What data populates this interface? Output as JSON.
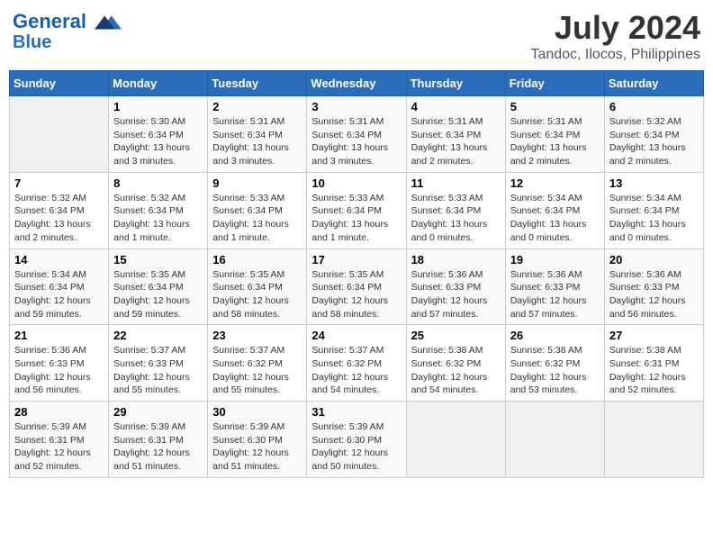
{
  "header": {
    "logo_line1": "General",
    "logo_line2": "Blue",
    "month": "July 2024",
    "location": "Tandoc, Ilocos, Philippines"
  },
  "weekdays": [
    "Sunday",
    "Monday",
    "Tuesday",
    "Wednesday",
    "Thursday",
    "Friday",
    "Saturday"
  ],
  "weeks": [
    [
      {
        "day": "",
        "info": ""
      },
      {
        "day": "1",
        "info": "Sunrise: 5:30 AM\nSunset: 6:34 PM\nDaylight: 13 hours\nand 3 minutes."
      },
      {
        "day": "2",
        "info": "Sunrise: 5:31 AM\nSunset: 6:34 PM\nDaylight: 13 hours\nand 3 minutes."
      },
      {
        "day": "3",
        "info": "Sunrise: 5:31 AM\nSunset: 6:34 PM\nDaylight: 13 hours\nand 3 minutes."
      },
      {
        "day": "4",
        "info": "Sunrise: 5:31 AM\nSunset: 6:34 PM\nDaylight: 13 hours\nand 2 minutes."
      },
      {
        "day": "5",
        "info": "Sunrise: 5:31 AM\nSunset: 6:34 PM\nDaylight: 13 hours\nand 2 minutes."
      },
      {
        "day": "6",
        "info": "Sunrise: 5:32 AM\nSunset: 6:34 PM\nDaylight: 13 hours\nand 2 minutes."
      }
    ],
    [
      {
        "day": "7",
        "info": "Sunrise: 5:32 AM\nSunset: 6:34 PM\nDaylight: 13 hours\nand 2 minutes."
      },
      {
        "day": "8",
        "info": "Sunrise: 5:32 AM\nSunset: 6:34 PM\nDaylight: 13 hours\nand 1 minute."
      },
      {
        "day": "9",
        "info": "Sunrise: 5:33 AM\nSunset: 6:34 PM\nDaylight: 13 hours\nand 1 minute."
      },
      {
        "day": "10",
        "info": "Sunrise: 5:33 AM\nSunset: 6:34 PM\nDaylight: 13 hours\nand 1 minute."
      },
      {
        "day": "11",
        "info": "Sunrise: 5:33 AM\nSunset: 6:34 PM\nDaylight: 13 hours\nand 0 minutes."
      },
      {
        "day": "12",
        "info": "Sunrise: 5:34 AM\nSunset: 6:34 PM\nDaylight: 13 hours\nand 0 minutes."
      },
      {
        "day": "13",
        "info": "Sunrise: 5:34 AM\nSunset: 6:34 PM\nDaylight: 13 hours\nand 0 minutes."
      }
    ],
    [
      {
        "day": "14",
        "info": "Sunrise: 5:34 AM\nSunset: 6:34 PM\nDaylight: 12 hours\nand 59 minutes."
      },
      {
        "day": "15",
        "info": "Sunrise: 5:35 AM\nSunset: 6:34 PM\nDaylight: 12 hours\nand 59 minutes."
      },
      {
        "day": "16",
        "info": "Sunrise: 5:35 AM\nSunset: 6:34 PM\nDaylight: 12 hours\nand 58 minutes."
      },
      {
        "day": "17",
        "info": "Sunrise: 5:35 AM\nSunset: 6:34 PM\nDaylight: 12 hours\nand 58 minutes."
      },
      {
        "day": "18",
        "info": "Sunrise: 5:36 AM\nSunset: 6:33 PM\nDaylight: 12 hours\nand 57 minutes."
      },
      {
        "day": "19",
        "info": "Sunrise: 5:36 AM\nSunset: 6:33 PM\nDaylight: 12 hours\nand 57 minutes."
      },
      {
        "day": "20",
        "info": "Sunrise: 5:36 AM\nSunset: 6:33 PM\nDaylight: 12 hours\nand 56 minutes."
      }
    ],
    [
      {
        "day": "21",
        "info": "Sunrise: 5:36 AM\nSunset: 6:33 PM\nDaylight: 12 hours\nand 56 minutes."
      },
      {
        "day": "22",
        "info": "Sunrise: 5:37 AM\nSunset: 6:33 PM\nDaylight: 12 hours\nand 55 minutes."
      },
      {
        "day": "23",
        "info": "Sunrise: 5:37 AM\nSunset: 6:32 PM\nDaylight: 12 hours\nand 55 minutes."
      },
      {
        "day": "24",
        "info": "Sunrise: 5:37 AM\nSunset: 6:32 PM\nDaylight: 12 hours\nand 54 minutes."
      },
      {
        "day": "25",
        "info": "Sunrise: 5:38 AM\nSunset: 6:32 PM\nDaylight: 12 hours\nand 54 minutes."
      },
      {
        "day": "26",
        "info": "Sunrise: 5:38 AM\nSunset: 6:32 PM\nDaylight: 12 hours\nand 53 minutes."
      },
      {
        "day": "27",
        "info": "Sunrise: 5:38 AM\nSunset: 6:31 PM\nDaylight: 12 hours\nand 52 minutes."
      }
    ],
    [
      {
        "day": "28",
        "info": "Sunrise: 5:39 AM\nSunset: 6:31 PM\nDaylight: 12 hours\nand 52 minutes."
      },
      {
        "day": "29",
        "info": "Sunrise: 5:39 AM\nSunset: 6:31 PM\nDaylight: 12 hours\nand 51 minutes."
      },
      {
        "day": "30",
        "info": "Sunrise: 5:39 AM\nSunset: 6:30 PM\nDaylight: 12 hours\nand 51 minutes."
      },
      {
        "day": "31",
        "info": "Sunrise: 5:39 AM\nSunset: 6:30 PM\nDaylight: 12 hours\nand 50 minutes."
      },
      {
        "day": "",
        "info": ""
      },
      {
        "day": "",
        "info": ""
      },
      {
        "day": "",
        "info": ""
      }
    ]
  ]
}
